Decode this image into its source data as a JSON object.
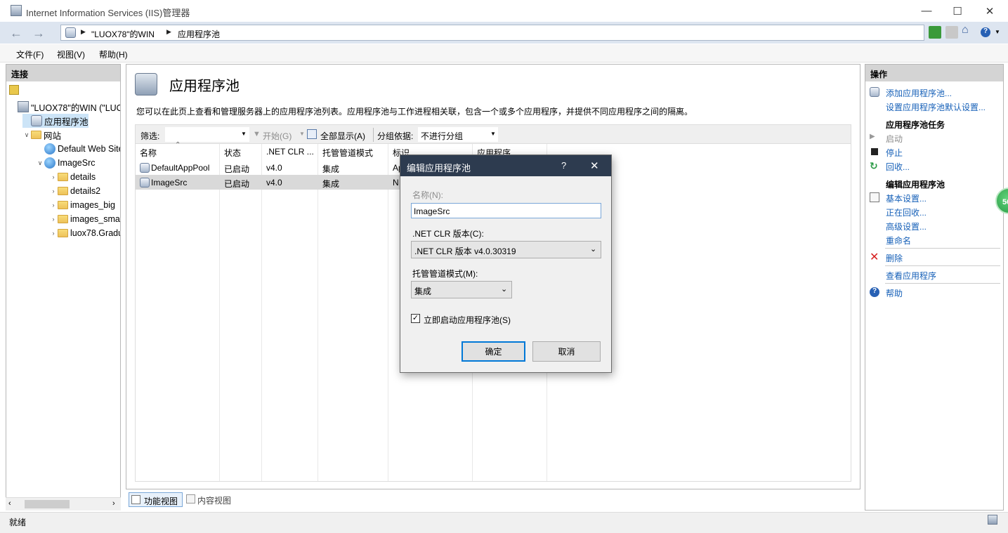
{
  "window": {
    "title": "Internet Information Services (IIS)管理器",
    "minimize": "—",
    "maximize": "☐",
    "close": "✕"
  },
  "address": {
    "crumbs": [
      "\"LUOX78\"的WIN",
      "应用程序池"
    ]
  },
  "menu": [
    "文件(F)",
    "视图(V)",
    "帮助(H)"
  ],
  "connections": {
    "header": "连接",
    "tree": [
      {
        "label": "\"LUOX78\"的WIN (\"LUOX",
        "level": 0,
        "icon": "server-icon",
        "exp": ""
      },
      {
        "label": "应用程序池",
        "level": 1,
        "icon": "app-pool-icon",
        "exp": "",
        "selected": true
      },
      {
        "label": "网站",
        "level": 1,
        "icon": "sites-folder-icon",
        "exp": "expanded"
      },
      {
        "label": "Default Web Site",
        "level": 2,
        "icon": "globe-icon",
        "exp": ""
      },
      {
        "label": "ImageSrc",
        "level": 2,
        "icon": "globe-icon",
        "exp": "expanded"
      },
      {
        "label": "details",
        "level": 3,
        "icon": "folder-icon",
        "exp": "collapsed"
      },
      {
        "label": "details2",
        "level": 3,
        "icon": "folder-icon",
        "exp": "collapsed"
      },
      {
        "label": "images_big",
        "level": 3,
        "icon": "folder-icon",
        "exp": "collapsed"
      },
      {
        "label": "images_small",
        "level": 3,
        "icon": "folder-icon",
        "exp": "collapsed"
      },
      {
        "label": "luox78.Gradua",
        "level": 3,
        "icon": "folder-icon",
        "exp": "collapsed"
      }
    ]
  },
  "main": {
    "title": "应用程序池",
    "description": "您可以在此页上查看和管理服务器上的应用程序池列表。应用程序池与工作进程相关联，包含一个或多个应用程序，并提供不同应用程序之间的隔离。",
    "filter": {
      "label": "筛选:",
      "value": "",
      "start_label": "开始(G)",
      "show_all_label": "全部显示(A)",
      "group_label": "分组依据:",
      "group_value": "不进行分组"
    },
    "columns": [
      "名称",
      "状态",
      ".NET CLR ...",
      "托管管道模式",
      "标识",
      "应用程序"
    ],
    "rows": [
      {
        "name": "DefaultAppPool",
        "status": "已启动",
        "clr": "v4.0",
        "pipeline": "集成",
        "identity": "Ap"
      },
      {
        "name": "ImageSrc",
        "status": "已启动",
        "clr": "v4.0",
        "pipeline": "集成",
        "identity": "N"
      }
    ],
    "view_tabs": [
      "功能视图",
      "内容视图"
    ]
  },
  "actions": {
    "header": "操作",
    "add_pool": "添加应用程序池...",
    "set_defaults": "设置应用程序池默认设置...",
    "tasks_header": "应用程序池任务",
    "start": "启动",
    "stop": "停止",
    "recycle": "回收...",
    "edit_header": "编辑应用程序池",
    "basic_settings": "基本设置...",
    "recycling": "正在回收...",
    "advanced_settings": "高级设置...",
    "rename": "重命名",
    "delete": "删除",
    "view_apps": "查看应用程序",
    "help": "帮助"
  },
  "badge": "56",
  "status": "就绪",
  "dialog": {
    "title": "编辑应用程序池",
    "help": "?",
    "close": "✕",
    "name_label": "名称(N):",
    "name_value": "ImageSrc",
    "clr_label": ".NET CLR 版本(C):",
    "clr_value": ".NET CLR 版本 v4.0.30319",
    "pipeline_label": "托管管道模式(M):",
    "pipeline_value": "集成",
    "autostart_label": "立即启动应用程序池(S)",
    "autostart_checked": true,
    "ok": "确定",
    "cancel": "取消"
  }
}
